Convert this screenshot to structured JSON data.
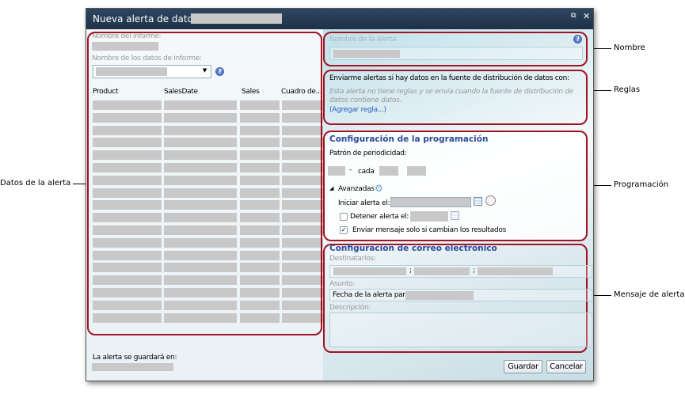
{
  "dialog": {
    "title": "Nueva alerta de datos -"
  },
  "left": {
    "report_name_label": "Nombre del informe:",
    "data_name_label": "Nombre de los datos de informe:",
    "columns": [
      "Product",
      "SalesDate",
      "Sales",
      "Cuadro de..."
    ],
    "row_count": 18,
    "save_location_label": "La alerta se guardará en:"
  },
  "name_section": {
    "label": "Nombre de la alerta"
  },
  "rules": {
    "heading": "Enviarme alertas si hay datos en la fuente de distribución de datos con:",
    "note": "Esta alerta no tiene reglas y se envía cuando la fuente de distribución de datos contiene datos.",
    "add_rule": "(Agregar regla...)"
  },
  "schedule": {
    "title": "Configuración de la programación",
    "pattern_label": "Patrón de periodicidad:",
    "every": "cada",
    "advanced": "Avanzadas",
    "start_label": "Iniciar alerta el:",
    "stop_label": "Detener alerta el:",
    "stop_checked": false,
    "only_changes_label": "Enviar mensaje solo si cambian los resultados",
    "only_changes_checked": true
  },
  "email": {
    "title": "Configuración de correo electrónico",
    "recipients_label": "Destinatarios:",
    "separator": ";",
    "subject_label": "Asunto:",
    "subject_value": "Fecha de la alerta para",
    "description_label": "Descripción:"
  },
  "buttons": {
    "save": "Guardar",
    "cancel": "Cancelar"
  },
  "callouts": {
    "data": "Datos de la alerta",
    "name": "Nombre",
    "rules": "Reglas",
    "schedule": "Programación",
    "message": "Mensaje de alerta"
  },
  "colors": {
    "highlight": "#a01422",
    "title_bar": "#2d4660",
    "section_title": "#2a4a9c"
  }
}
